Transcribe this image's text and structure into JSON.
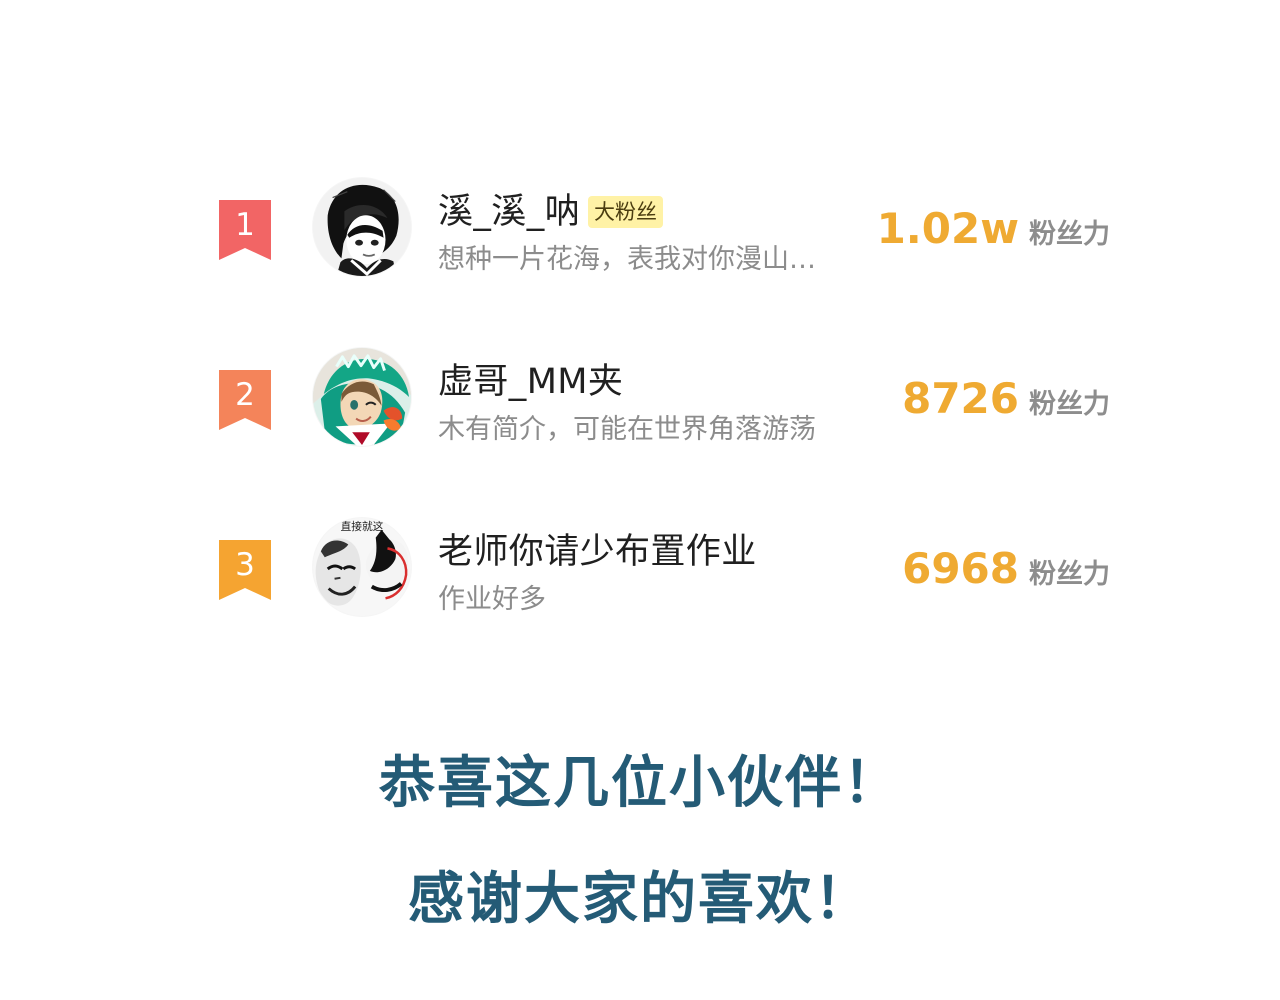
{
  "fans": [
    {
      "rank": "1",
      "rank_color": "#f26565",
      "name": "溪_溪_呐",
      "tag": "大粉丝",
      "bio": "想种一片花海，表我对你漫山…",
      "stat_value": "1.02w",
      "stat_unit": "粉丝力",
      "avatar_icon": "dark-hair-anime-avatar-icon"
    },
    {
      "rank": "2",
      "rank_color": "#f4845a",
      "name": "虚哥_MM夹",
      "tag": "",
      "bio": "木有简介，可能在世界角落游荡",
      "stat_value": "8726",
      "stat_unit": "粉丝力",
      "avatar_icon": "green-dino-hood-avatar-icon"
    },
    {
      "rank": "3",
      "rank_color": "#f5a431",
      "name": "老师你请少布置作业",
      "tag": "",
      "bio": "作业好多",
      "stat_value": "6968",
      "stat_unit": "粉丝力",
      "avatar_icon": "meme-face-avatar-icon",
      "avatar_caption": "直接就这"
    }
  ],
  "closing": {
    "line1": "恭喜这几位小伙伴！",
    "line2": "感谢大家的喜欢！"
  },
  "colors": {
    "name_text": "#202020",
    "bio_text": "#8c8c8c",
    "stat_value": "#efaa32",
    "stat_unit": "#8d8d8d",
    "tag_bg": "#fff2a6",
    "closing_text": "#245b76"
  }
}
